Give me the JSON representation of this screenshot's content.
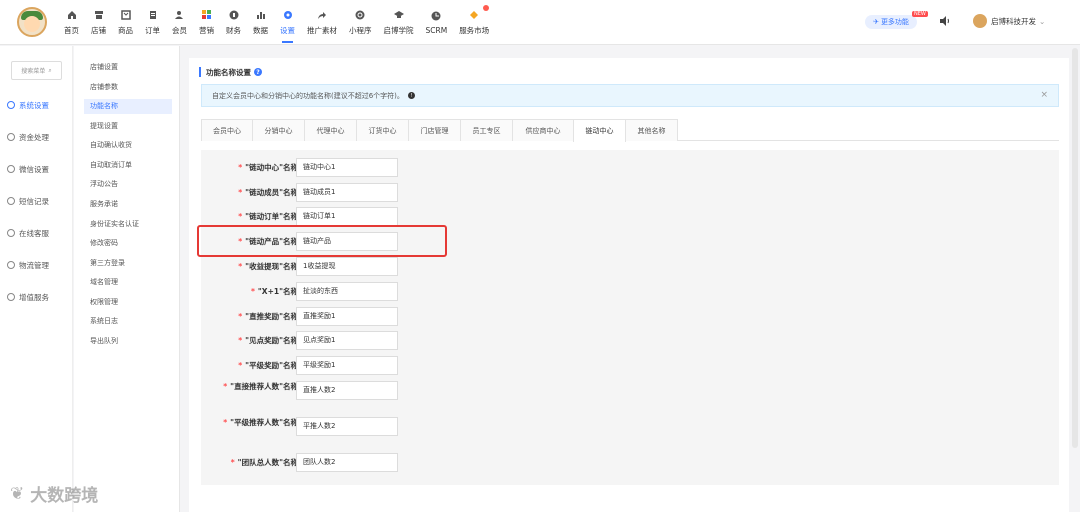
{
  "nav": [
    {
      "label": "首页",
      "icon": "home-icon"
    },
    {
      "label": "店铺",
      "icon": "store-icon"
    },
    {
      "label": "商品",
      "icon": "goods-icon"
    },
    {
      "label": "订单",
      "icon": "order-icon"
    },
    {
      "label": "会员",
      "icon": "member-icon"
    },
    {
      "label": "营销",
      "icon": "marketing-icon"
    },
    {
      "label": "财务",
      "icon": "finance-icon"
    },
    {
      "label": "数据",
      "icon": "data-icon"
    },
    {
      "label": "设置",
      "icon": "settings-icon"
    },
    {
      "label": "推广素材",
      "icon": "share-icon"
    },
    {
      "label": "小程序",
      "icon": "miniapp-icon"
    },
    {
      "label": "启博学院",
      "icon": "academy-icon"
    },
    {
      "label": "SCRM",
      "icon": "scrm-icon"
    },
    {
      "label": "服务市场",
      "icon": "market-icon"
    }
  ],
  "header": {
    "more_label": "更多功能",
    "new_tag": "NEW",
    "user_name": "启博科技开发"
  },
  "sidebar": {
    "search_placeholder": "搜索菜单",
    "items": [
      "系统设置",
      "资金处理",
      "微信设置",
      "短信记录",
      "在线客服",
      "物流管理",
      "增值服务"
    ]
  },
  "subnav": [
    "店铺设置",
    "店铺参数",
    "功能名称",
    "提现设置",
    "自动确认收货",
    "自动取消订单",
    "浮动公告",
    "服务承诺",
    "身份证实名认证",
    "修改密码",
    "第三方登录",
    "域名管理",
    "权限管理",
    "系统日志",
    "导出队列"
  ],
  "main": {
    "section_title": "功能名称设置",
    "notice": "自定义会员中心和分销中心的功能名称(建议不超过6个字符)。",
    "tabs": [
      "会员中心",
      "分销中心",
      "代理中心",
      "订货中心",
      "门店管理",
      "员工专区",
      "供应商中心",
      "链动中心",
      "其他名称"
    ],
    "active_tab": "链动中心",
    "fields": [
      {
        "label": "\"链动中心\"名称:",
        "value": "链动中心1"
      },
      {
        "label": "\"链动成员\"名称:",
        "value": "链动成员1"
      },
      {
        "label": "\"链动订单\"名称:",
        "value": "链动订单1"
      },
      {
        "label": "\"链动产品\"名称:",
        "value": "链动产品"
      },
      {
        "label": "\"收益提现\"名称:",
        "value": "1收益提现"
      },
      {
        "label": "\"X+1\"名称:",
        "value": "扯淡的东西"
      },
      {
        "label": "\"直推奖励\"名称:",
        "value": "直推奖励1"
      },
      {
        "label": "\"见点奖励\"名称:",
        "value": "见点奖励1"
      },
      {
        "label": "\"平级奖励\"名称:",
        "value": "平级奖励1"
      },
      {
        "label": "\"直接推荐人数\"名称:",
        "value": "直推人数2"
      },
      {
        "label": "\"平级推荐人数\"名称:",
        "value": "平推人数2"
      },
      {
        "label": "\"团队总人数\"名称:",
        "value": "团队人数2"
      }
    ]
  },
  "watermark": "大数跨境"
}
